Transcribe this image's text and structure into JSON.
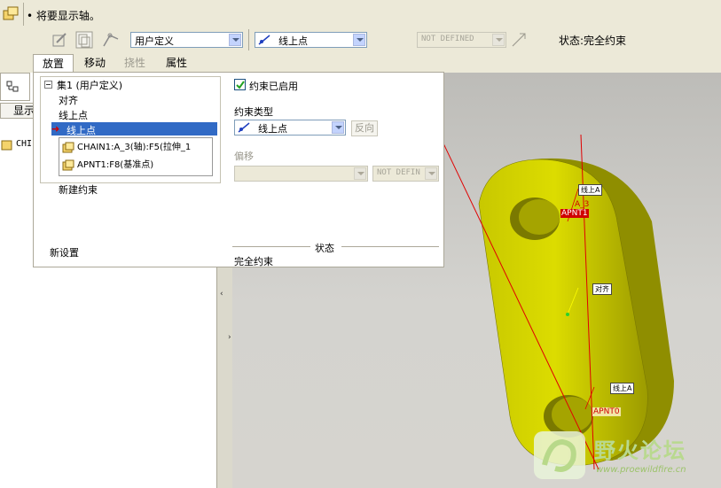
{
  "message": "将要显示轴。",
  "toolbar": {
    "set_type": "用户定义",
    "constraint_type": "线上点",
    "offset_value": "NOT DEFINED",
    "status": "状态:完全约束"
  },
  "tabs": [
    "放置",
    "移动",
    "挠性",
    "属性"
  ],
  "left_panel": {
    "tab_label": "显示",
    "tree_item": "CHI"
  },
  "tree": {
    "set_label": "集1 (用户定义)",
    "items": [
      "对齐",
      "线上点",
      "线上点"
    ],
    "new_constraint": "新建约束",
    "new_set": "新设置"
  },
  "references": [
    "CHAIN1:A_3(轴):F5(拉伸_1",
    "APNT1:F8(基准点)"
  ],
  "constraint_panel": {
    "enabled_label": "约束已启用",
    "enabled_checked": true,
    "type_label": "约束类型",
    "type_value": "线上点",
    "flip_label": "反向",
    "offset_label": "偏移",
    "offset_unit": "NOT DEFIN",
    "status_label": "状态",
    "status_value": "完全约束"
  },
  "viewport_labels": {
    "tag_top": "线上A",
    "axis": "A_3",
    "point_top": "APNT1",
    "tag_mid": "对齐",
    "tag_bottom": "线上A",
    "point_bottom": "APNT0"
  },
  "watermark": {
    "title": "野火论坛",
    "url": "www.proewildfire.cn"
  },
  "colors": {
    "part": "#d7d600",
    "axis": "#e00000",
    "selection": "#316ac5"
  }
}
